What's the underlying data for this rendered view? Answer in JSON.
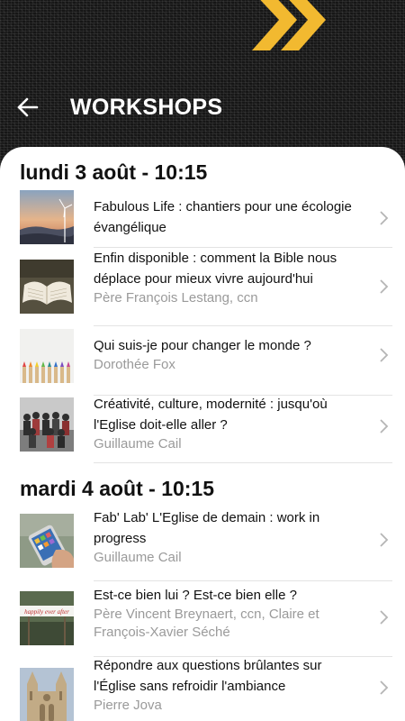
{
  "header": {
    "title": "WORKSHOPS"
  },
  "sections": [
    {
      "day": "lundi 3 août - 10:15",
      "items": [
        {
          "title_lines": [
            "Fabulous Life : chantiers pour une écologie",
            "évangélique"
          ],
          "subtitle_lines": []
        },
        {
          "title_lines": [
            "Enfin disponible : comment la Bible nous",
            "déplace pour mieux vivre aujourd'hui"
          ],
          "subtitle_lines": [
            "Père François Lestang, ccn"
          ]
        },
        {
          "title_lines": [
            "Qui suis-je pour changer le monde ?"
          ],
          "subtitle_lines": [
            "Dorothée Fox"
          ]
        },
        {
          "title_lines": [
            "Créativité, culture, modernité : jusqu'où",
            "l'Eglise doit-elle aller ?"
          ],
          "subtitle_lines": [
            "Guillaume Cail"
          ]
        }
      ]
    },
    {
      "day": "mardi 4 août - 10:15",
      "items": [
        {
          "title_lines": [
            "Fab' Lab' L'Eglise de demain : work in",
            "progress"
          ],
          "subtitle_lines": [
            "Guillaume Cail"
          ]
        },
        {
          "title_lines": [
            "Est-ce bien lui ? Est-ce bien elle ?"
          ],
          "subtitle_lines": [
            "Père Vincent Breynaert, ccn, Claire et",
            "François-Xavier Séché"
          ]
        },
        {
          "title_lines": [
            "Répondre aux questions brûlantes sur",
            "l'Église sans refroidir l'ambiance"
          ],
          "subtitle_lines": [
            "Pierre Jova"
          ]
        }
      ]
    }
  ],
  "thumb_signs": {
    "sign_text": "happily ever after"
  },
  "colors": {
    "accent": "#f2b930",
    "subtitle": "#9a9a9a",
    "divider": "#e3e3e3"
  }
}
